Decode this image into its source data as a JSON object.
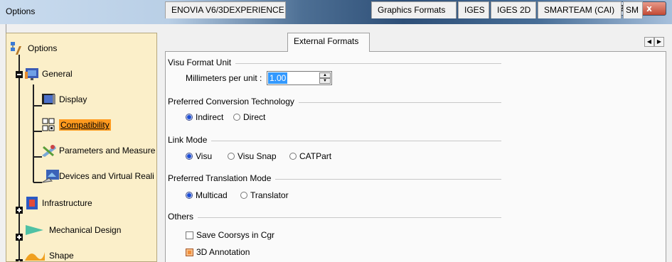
{
  "window": {
    "title": "Options",
    "help_glyph": "?",
    "close_glyph": "x"
  },
  "tree": {
    "root": "Options",
    "items": [
      {
        "label": "General"
      },
      {
        "label": "Display"
      },
      {
        "label": "Compatibility"
      },
      {
        "label": "Parameters and Measure"
      },
      {
        "label": "Devices and Virtual Reali"
      },
      {
        "label": "Infrastructure"
      },
      {
        "label": "Mechanical Design"
      },
      {
        "label": "Shape"
      }
    ]
  },
  "tabs": [
    {
      "label": "ENOVIA V6/3DEXPERIENCE"
    },
    {
      "label": "External Formats"
    },
    {
      "label": "Graphics Formats"
    },
    {
      "label": "IGES"
    },
    {
      "label": "IGES 2D"
    },
    {
      "label": "SMARTEAM (CAI)"
    },
    {
      "label": "SM"
    }
  ],
  "tab_arrows": {
    "left": "◀",
    "right": "▶"
  },
  "groups": {
    "visu_format_unit": {
      "title": "Visu Format Unit",
      "mm_label": "Millimeters per unit :",
      "mm_value": "1.00"
    },
    "conversion": {
      "title": "Preferred Conversion Technology",
      "options": [
        "Indirect",
        "Direct"
      ]
    },
    "link_mode": {
      "title": "Link Mode",
      "options": [
        "Visu",
        "Visu Snap",
        "CATPart"
      ]
    },
    "translation": {
      "title": "Preferred Translation Mode",
      "options": [
        "Multicad",
        "Translator"
      ]
    },
    "others": {
      "title": "Others",
      "save_coorsys": "Save Coorsys in Cgr",
      "annotation": "3D Annotation"
    }
  },
  "colors": {
    "tree_bg": "#fbefc9",
    "selection": "#ff9a1f",
    "radio_on": "#1a4bd6",
    "checkbox_on": "#f08d3a"
  }
}
